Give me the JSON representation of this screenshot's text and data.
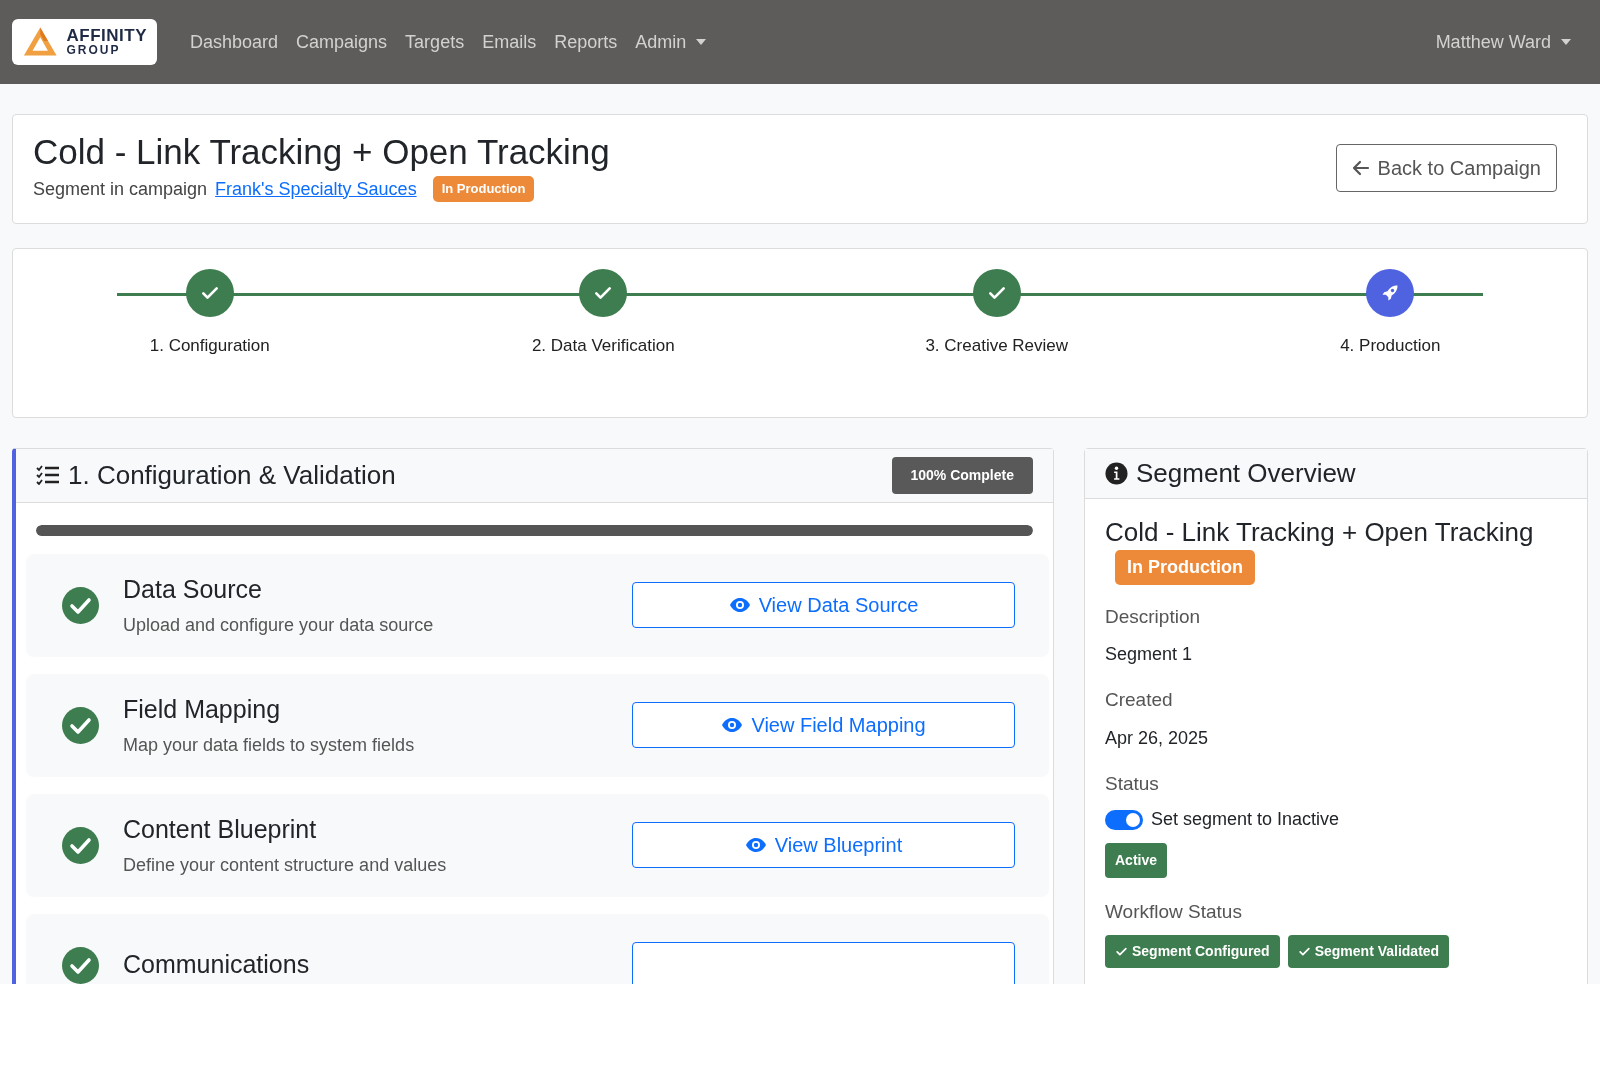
{
  "navbar": {
    "logo": {
      "line1": "AFFINITY",
      "line2": "GROUP"
    },
    "links": [
      {
        "label": "Dashboard",
        "dropdown": false
      },
      {
        "label": "Campaigns",
        "dropdown": false
      },
      {
        "label": "Targets",
        "dropdown": false
      },
      {
        "label": "Emails",
        "dropdown": false
      },
      {
        "label": "Reports",
        "dropdown": false
      },
      {
        "label": "Admin",
        "dropdown": true
      }
    ],
    "user": {
      "label": "Matthew Ward",
      "dropdown": true
    }
  },
  "header": {
    "title": "Cold - Link Tracking + Open Tracking",
    "subtitle": "Segment in campaign",
    "campaign_link": "Frank's Specialty Sauces",
    "status_badge": "In Production",
    "back_button": "Back to Campaign"
  },
  "stepper": [
    {
      "label": "1. Configuration",
      "completed": true
    },
    {
      "label": "2. Data Verification",
      "completed": true
    },
    {
      "label": "3. Creative Review",
      "completed": true
    },
    {
      "label": "4. Production",
      "completed": false
    }
  ],
  "config_panel": {
    "title": "1. Configuration & Validation",
    "badge": "100% Complete",
    "level": 1.0,
    "items": [
      {
        "title": "Data Source",
        "description": "Upload and configure your data source",
        "done": true,
        "button_label": "View Data Source",
        "has_button": true
      },
      {
        "title": "Field Mapping",
        "description": "Map your data fields to system fields",
        "done": true,
        "button_label": "View Field Mapping",
        "has_button": true
      },
      {
        "title": "Content Blueprint",
        "description": "Define your content structure and values",
        "done": true,
        "button_label": "View Blueprint",
        "has_button": true
      },
      {
        "title": "Communications",
        "done": true,
        "has_button": true
      }
    ]
  },
  "overview": {
    "title": "Segment Overview",
    "name": "Cold - Link Tracking + Open Tracking",
    "status_badge": "In Production",
    "description_label": "Description",
    "description": "Segment 1",
    "created_label": "Created",
    "created": "Apr 26, 2025",
    "status_label": "Status",
    "toggle": {
      "label": "Set segment to Inactive",
      "on": true
    },
    "active_badge": "Active",
    "workflow_label": "Workflow Status",
    "workflow": [
      {
        "label": "Segment Configured",
        "done": true
      },
      {
        "label": "Segment Validated",
        "done": true
      }
    ]
  }
}
